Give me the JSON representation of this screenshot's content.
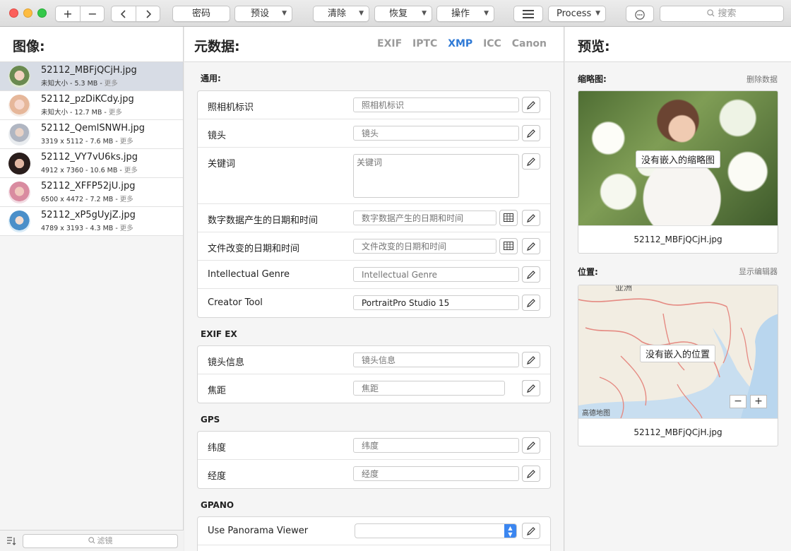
{
  "toolbar": {
    "buttons": {
      "add": "+",
      "remove": "−",
      "password": "密码",
      "preset": "预设",
      "clear": "清除",
      "restore": "恢复",
      "actions": "操作",
      "process": "Process"
    },
    "search_placeholder": "搜索"
  },
  "images_panel": {
    "title": "图像:",
    "files": [
      {
        "name": "52112_MBFjQCjH.jpg",
        "info": "未知大小 - 5.3 MB - ",
        "more": "更多"
      },
      {
        "name": "52112_pzDiKCdy.jpg",
        "info": "未知大小 - 12.7 MB - ",
        "more": "更多"
      },
      {
        "name": "52112_QemlSNWH.jpg",
        "info": "3319 x 5112 - 7.6 MB - ",
        "more": "更多"
      },
      {
        "name": "52112_VY7vU6ks.jpg",
        "info": "4912 x 7360 - 10.6 MB - ",
        "more": "更多"
      },
      {
        "name": "52112_XFFP52jU.jpg",
        "info": "6500 x 4472 - 7.2 MB - ",
        "more": "更多"
      },
      {
        "name": "52112_xP5gUyjZ.jpg",
        "info": "4789 x 3193 - 4.3 MB - ",
        "more": "更多"
      }
    ],
    "filter_placeholder": "滤镜"
  },
  "metadata_panel": {
    "title": "元数据:",
    "tabs": [
      "EXIF",
      "IPTC",
      "XMP",
      "ICC",
      "Canon"
    ],
    "active_tab": "XMP",
    "sections": {
      "general": {
        "title": "通用:",
        "camera_id": {
          "label": "照相机标识",
          "placeholder": "照相机标识"
        },
        "lens": {
          "label": "镜头",
          "placeholder": "镜头"
        },
        "keywords": {
          "label": "关键词",
          "placeholder": "关键词"
        },
        "digitized_date": {
          "label": "数字数据产生的日期和时间",
          "placeholder": "数字数据产生的日期和时间"
        },
        "modified_date": {
          "label": "文件改变的日期和时间",
          "placeholder": "文件改变的日期和时间"
        },
        "intellectual_genre": {
          "label": "Intellectual Genre",
          "placeholder": "Intellectual Genre"
        },
        "creator_tool": {
          "label": "Creator Tool",
          "value": "PortraitPro Studio 15"
        }
      },
      "exif_ex": {
        "title": "EXIF EX",
        "lens_info": {
          "label": "镜头信息",
          "placeholder": "镜头信息"
        },
        "focal_length": {
          "label": "焦距",
          "placeholder": "焦距"
        }
      },
      "gps": {
        "title": "GPS",
        "latitude": {
          "label": "纬度",
          "placeholder": "纬度"
        },
        "longitude": {
          "label": "经度",
          "placeholder": "经度"
        }
      },
      "gpano": {
        "title": "GPANO",
        "use_panorama_viewer": {
          "label": "Use Panorama Viewer"
        }
      }
    }
  },
  "preview_panel": {
    "title": "预览:",
    "thumbnail": {
      "title": "缩略图:",
      "action": "删除数据",
      "overlay": "没有嵌入的缩略图",
      "caption": "52112_MBFjQCjH.jpg"
    },
    "location": {
      "title": "位置:",
      "action": "显示编辑器",
      "overlay": "没有嵌入的位置",
      "caption": "52112_MBFjQCjH.jpg",
      "map_label_top": "亚洲",
      "map_attribution": "高德地图",
      "zoom_out": "−",
      "zoom_in": "+"
    }
  },
  "colors": {
    "accent": "#2f7ad6",
    "selection": "#d7dce5"
  }
}
